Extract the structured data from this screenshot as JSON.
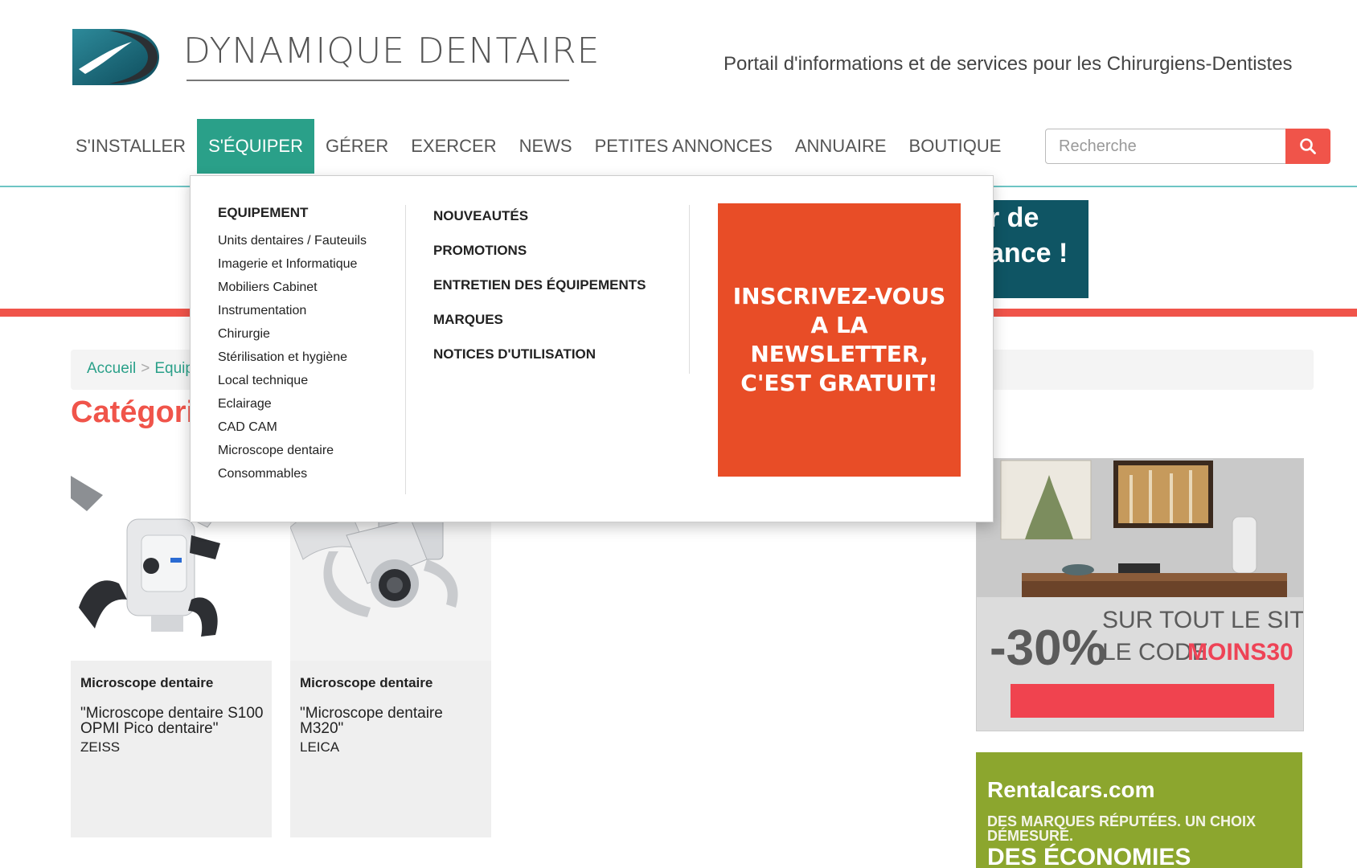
{
  "header": {
    "logo_text": "DYNAMIQUE DENTAIRE",
    "tagline": "Portail d'informations et de services pour les Chirurgiens-Dentistes"
  },
  "nav": {
    "items": [
      {
        "label": "S'INSTALLER"
      },
      {
        "label": "S'ÉQUIPER",
        "active": true
      },
      {
        "label": "GÉRER"
      },
      {
        "label": "EXERCER"
      },
      {
        "label": "NEWS"
      },
      {
        "label": "PETITES ANNONCES"
      },
      {
        "label": "ANNUAIRE"
      },
      {
        "label": "BOUTIQUE"
      }
    ],
    "search_placeholder": "Recherche"
  },
  "banner": {
    "line1": "r de",
    "line2": "ance !"
  },
  "breadcrumb": {
    "home": "Accueil",
    "separator": ">",
    "current": "Equip"
  },
  "page_title": "Catégori",
  "dropdown": {
    "col1_heading": "EQUIPEMENT",
    "col1_links": [
      "Units dentaires / Fauteuils",
      "Imagerie et Informatique",
      "Mobiliers Cabinet",
      "Instrumentation",
      "Chirurgie",
      "Stérilisation et hygiène",
      "Local technique",
      "Eclairage",
      "CAD CAM",
      "Microscope dentaire",
      "Consommables"
    ],
    "col2_links": [
      "NOUVEAUTÉS",
      "PROMOTIONS",
      "ENTRETIEN DES ÉQUIPEMENTS",
      "MARQUES",
      "NOTICES D'UTILISATION"
    ],
    "newsletter": "INSCRIVEZ-VOUS A LA NEWSLETTER, C'EST GRATUIT!"
  },
  "products": [
    {
      "category": "Microscope dentaire",
      "name": "\"Microscope dentaire S100 OPMI Pico dentaire\"",
      "brand": "ZEISS"
    },
    {
      "category": "Microscope dentaire",
      "name": "\"Microscope dentaire M320\"",
      "brand": "LEICA"
    }
  ],
  "ads": {
    "ad1_discount": "-30%",
    "ad1_line1": "SUR TOUT LE SITE AVEC",
    "ad1_line2_prefix": "LE CODE",
    "ad1_code": "MOINS30",
    "ad2_brand": "Rentalcars.com",
    "ad2_line1": "DES MARQUES RÉPUTÉES. UN CHOIX",
    "ad2_line2": "DÉMESURÉ.",
    "ad2_line3": "DES ÉCONOMIES"
  },
  "colors": {
    "teal": "#2aa089",
    "red": "#f0544a",
    "newsletter": "#e84d27"
  }
}
